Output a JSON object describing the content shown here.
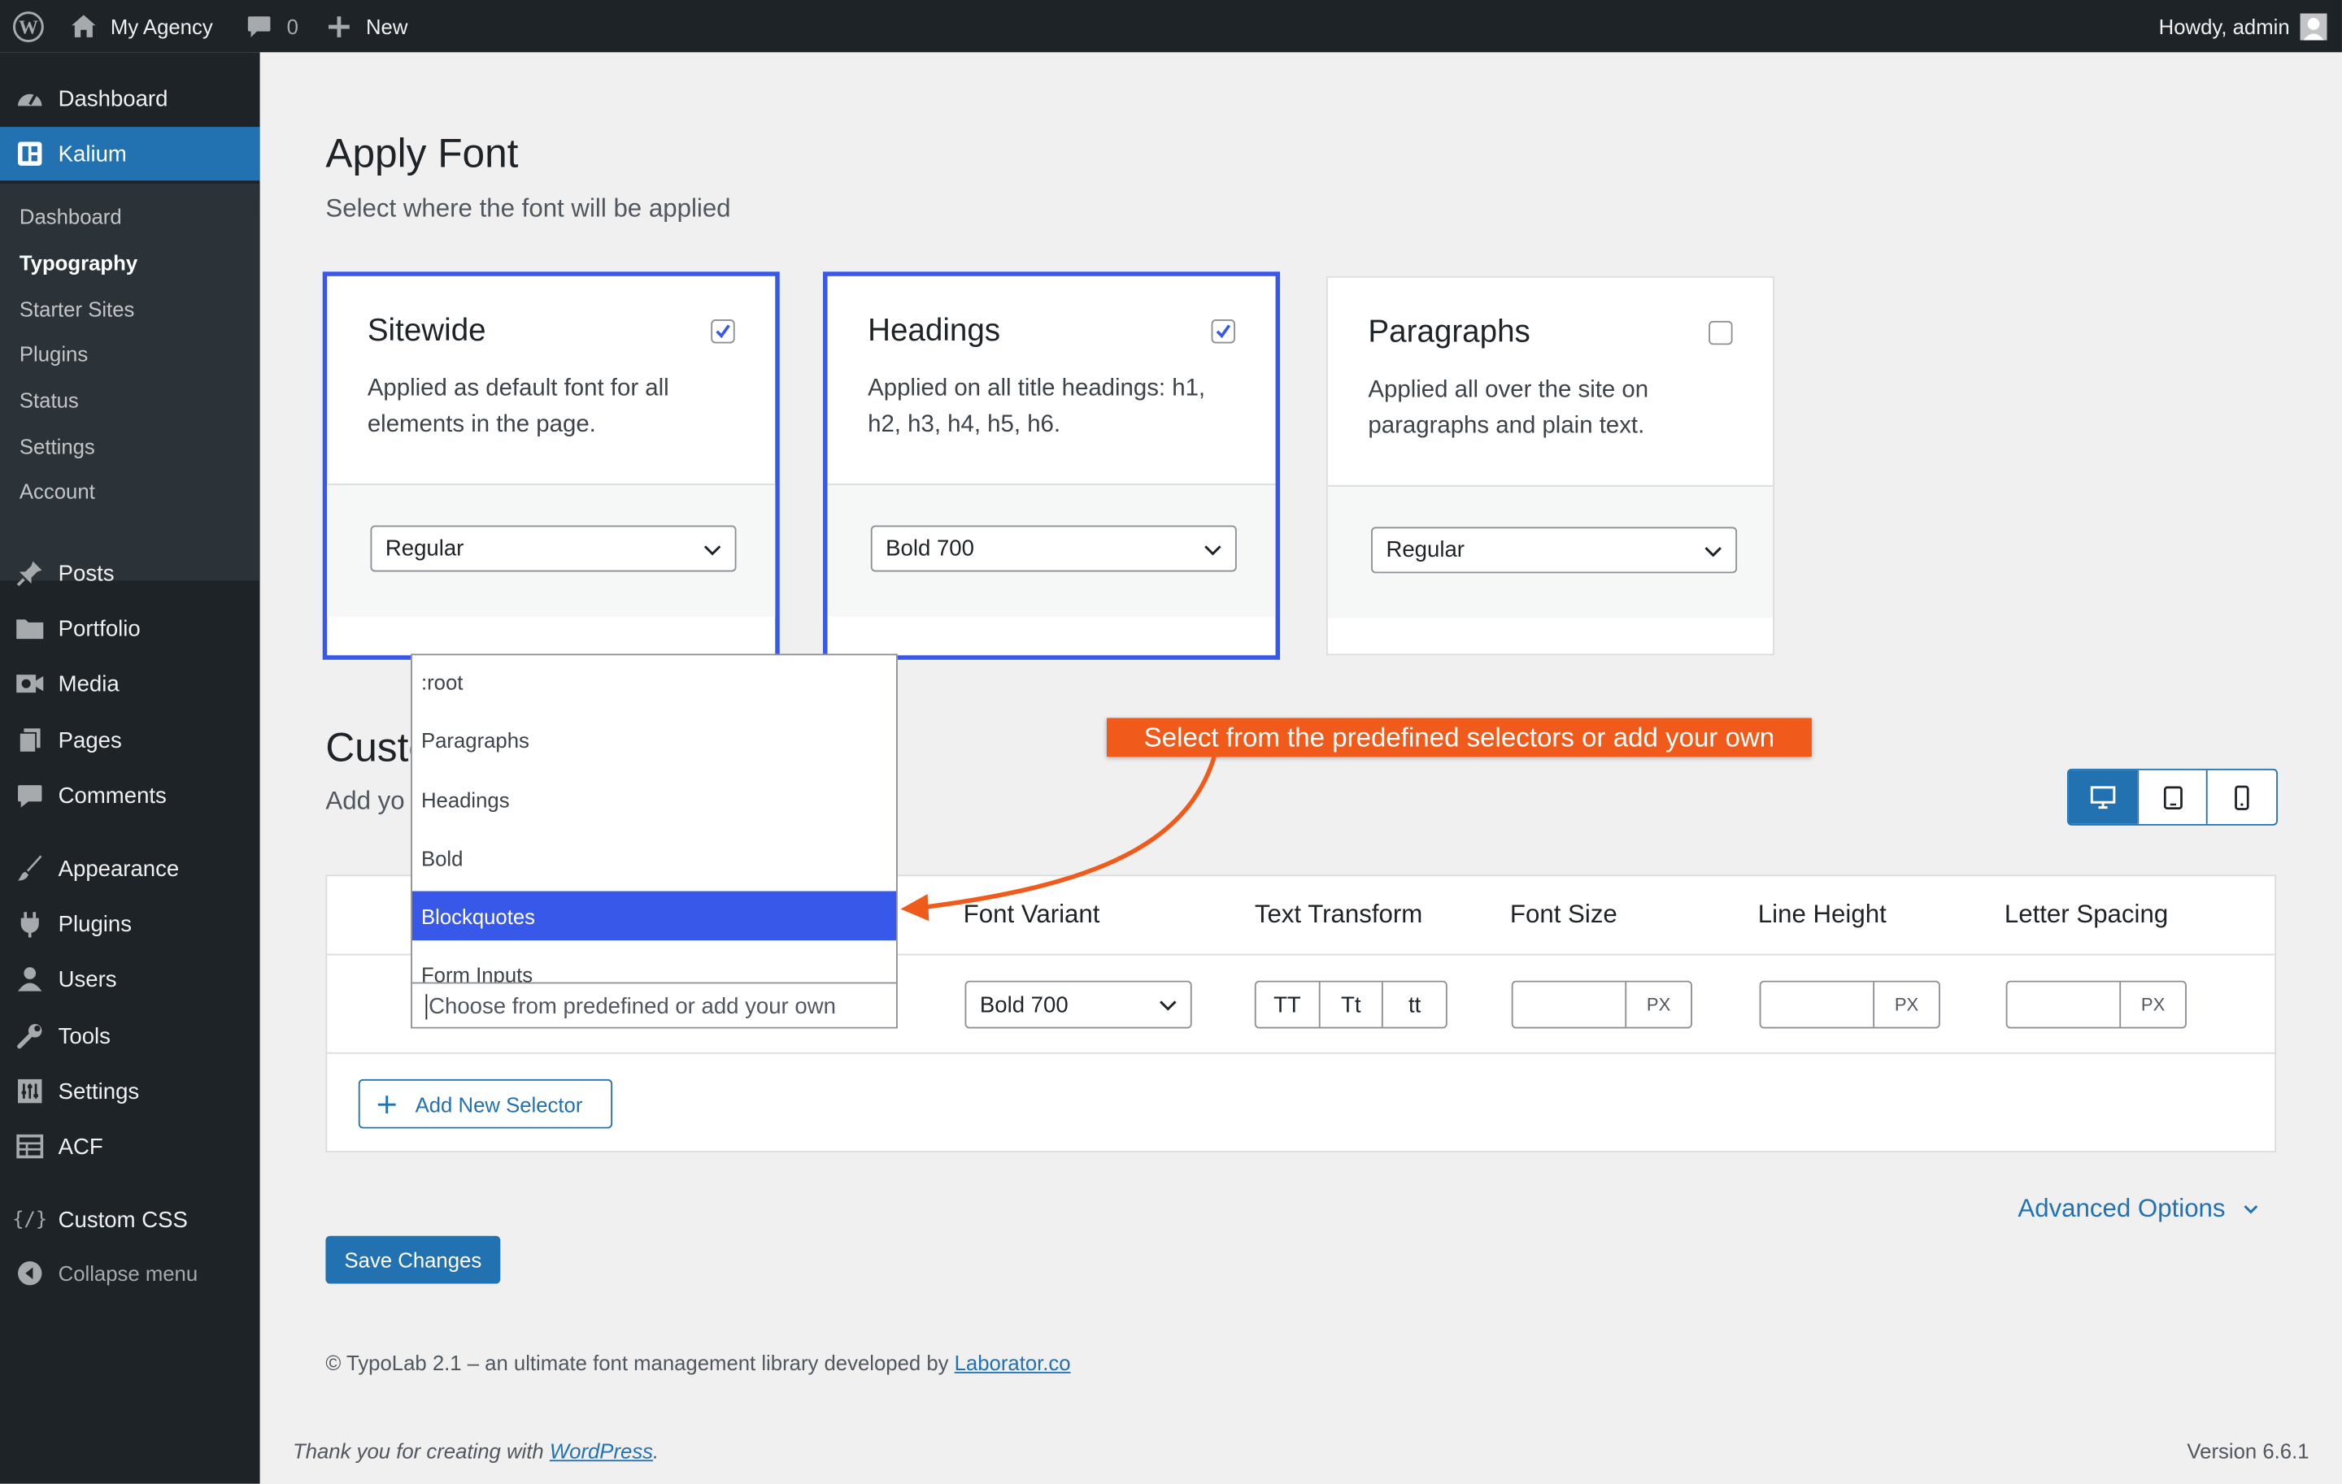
{
  "adminbar": {
    "site": "My Agency",
    "comments": "0",
    "new": "New",
    "howdy": "Howdy, admin"
  },
  "sidebar": {
    "top": [
      {
        "label": "Dashboard"
      },
      {
        "label": "Kalium"
      }
    ],
    "submenu": [
      "Dashboard",
      "Typography",
      "Starter Sites",
      "Plugins",
      "Status",
      "Settings",
      "Account"
    ],
    "items": [
      {
        "label": "Posts"
      },
      {
        "label": "Portfolio"
      },
      {
        "label": "Media"
      },
      {
        "label": "Pages"
      },
      {
        "label": "Comments"
      },
      {
        "label": "Appearance"
      },
      {
        "label": "Plugins"
      },
      {
        "label": "Users"
      },
      {
        "label": "Tools"
      },
      {
        "label": "Settings"
      },
      {
        "label": "ACF"
      },
      {
        "label": "Custom CSS"
      },
      {
        "label": "Collapse menu"
      }
    ]
  },
  "main": {
    "title": "Apply Font",
    "subtitle": "Select where the font will be applied",
    "cards": [
      {
        "title": "Sitewide",
        "desc": "Applied as default font for all elements in the page.",
        "checked": true,
        "variant": "Regular"
      },
      {
        "title": "Headings",
        "desc": "Applied on all title headings: h1, h2, h3, h4, h5, h6.",
        "checked": true,
        "variant": "Bold 700"
      },
      {
        "title": "Paragraphs",
        "desc": "Applied all over the site on paragraphs and plain text.",
        "checked": false,
        "variant": "Regular"
      }
    ],
    "custom_title_partial": "Custo",
    "custom_sub_partial": "Add yo",
    "columns": [
      "Font Variant",
      "Text Transform",
      "Font Size",
      "Line Height",
      "Letter Spacing"
    ],
    "row": {
      "variant": "Bold 700",
      "transforms": [
        "TT",
        "Tt",
        "tt"
      ],
      "unit": "PX"
    },
    "add_selector": "Add New Selector",
    "advanced": "Advanced Options",
    "save": "Save Changes",
    "credit_prefix": "© TypoLab 2.1 – an ultimate font management library developed by ",
    "credit_link": "Laborator.co",
    "thanks_prefix": "Thank you for creating with ",
    "thanks_link": "WordPress",
    "version": "Version 6.6.1"
  },
  "dropdown": {
    "options": [
      ":root",
      "Paragraphs",
      "Headings",
      "Bold",
      "Blockquotes",
      "Form Inputs"
    ],
    "highlighted": "Blockquotes",
    "placeholder": "Choose from predefined or add your own"
  },
  "callout": "Select from the predefined selectors or add your own",
  "colors": {
    "wp_blue": "#2271b1",
    "highlight": "#3858e9",
    "callout": "#f05a1a",
    "dark": "#1d2327"
  }
}
